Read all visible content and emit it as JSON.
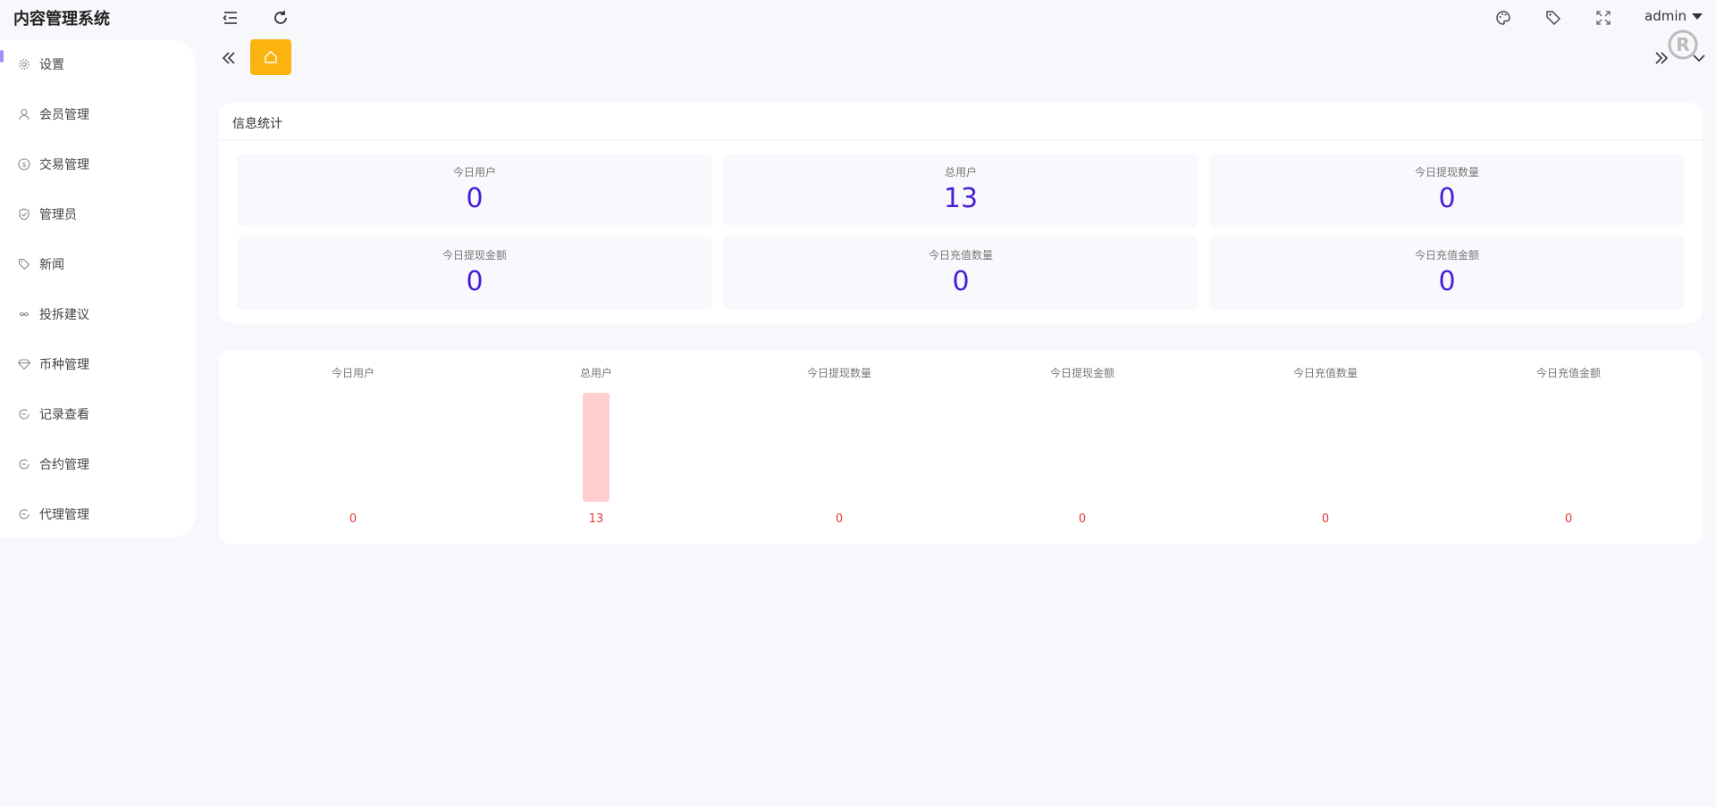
{
  "app": {
    "title": "内容管理系统"
  },
  "header": {
    "user": "admin"
  },
  "sidebar": {
    "items": [
      {
        "label": "设置",
        "icon": "gear-icon"
      },
      {
        "label": "会员管理",
        "icon": "user-icon"
      },
      {
        "label": "交易管理",
        "icon": "dollar-icon"
      },
      {
        "label": "管理员",
        "icon": "shield-icon"
      },
      {
        "label": "新闻",
        "icon": "tag-icon"
      },
      {
        "label": "投拆建议",
        "icon": "infinity-icon"
      },
      {
        "label": "币种管理",
        "icon": "diamond-icon"
      },
      {
        "label": "记录查看",
        "icon": "record-icon"
      },
      {
        "label": "合约管理",
        "icon": "record-icon"
      },
      {
        "label": "代理管理",
        "icon": "record-icon"
      }
    ]
  },
  "stats": {
    "title": "信息统计",
    "items": [
      {
        "label": "今日用户",
        "value": "0"
      },
      {
        "label": "总用户",
        "value": "13"
      },
      {
        "label": "今日提现数量",
        "value": "0"
      },
      {
        "label": "今日提现金额",
        "value": "0"
      },
      {
        "label": "今日充值数量",
        "value": "0"
      },
      {
        "label": "今日充值金额",
        "value": "0"
      }
    ]
  },
  "chart_data": {
    "type": "bar",
    "categories": [
      "今日用户",
      "总用户",
      "今日提现数量",
      "今日提现金额",
      "今日充值数量",
      "今日充值金额"
    ],
    "values": [
      0,
      13,
      0,
      0,
      0,
      0
    ],
    "bar_color": "#ffcfcf",
    "label_color": "#e53935",
    "grid": false
  },
  "colors": {
    "accent": "#fbb310",
    "value": "#4a1ed8",
    "indicator": "#a78bfa"
  }
}
